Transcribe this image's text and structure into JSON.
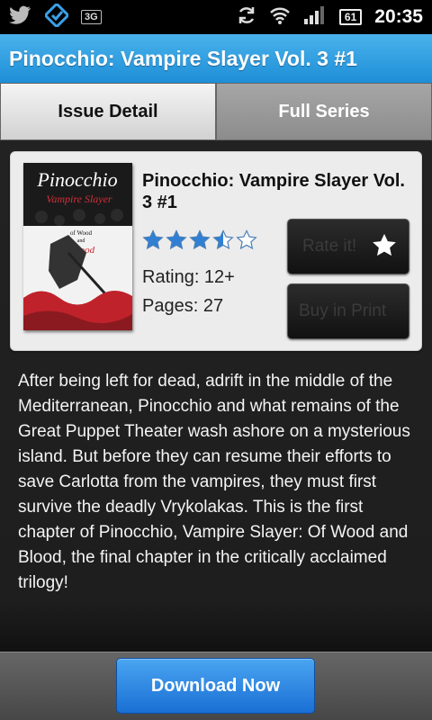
{
  "status_bar": {
    "time": "20:35",
    "network_badge": "3G",
    "battery": "61",
    "icons": [
      "twitter-icon",
      "tasks-check-icon",
      "3g-icon",
      "sync-icon",
      "wifi-icon",
      "signal-icon",
      "battery-icon"
    ]
  },
  "app_bar": {
    "title": "Pinocchio: Vampire Slayer Vol. 3 #1"
  },
  "tabs": [
    {
      "label": "Issue Detail",
      "selected": true
    },
    {
      "label": "Full Series",
      "selected": false
    }
  ],
  "issue": {
    "title": "Pinocchio: Vampire Slayer Vol. 3 #1",
    "star_rating": 3.5,
    "star_max": 5,
    "rating_text": "Rating: 12+",
    "pages_text": "Pages: 27",
    "cover": {
      "title_line1": "Pinocchio",
      "title_line2": "Vampire Slayer",
      "subtitle_of": "of Wood",
      "subtitle_and": "and",
      "subtitle_blood": "Blood"
    },
    "description": "After being left for dead, adrift in the middle of the Mediterranean, Pinocchio and what remains of the Great Puppet Theater wash ashore on a mysterious island. But before they can resume their efforts to save Carlotta from the vampires, they must first survive the deadly Vrykolakas. This is the first chapter of Pinocchio, Vampire Slayer: Of Wood and Blood, the final chapter in the critically acclaimed trilogy!"
  },
  "actions": {
    "rate_label": "Rate it!",
    "buy_label": "Buy in Print",
    "download_label": "Download Now"
  },
  "colors": {
    "app_bar": "#2a9ee0",
    "star_fill": "#2f7fd4",
    "download_button": "#2a86e0"
  }
}
